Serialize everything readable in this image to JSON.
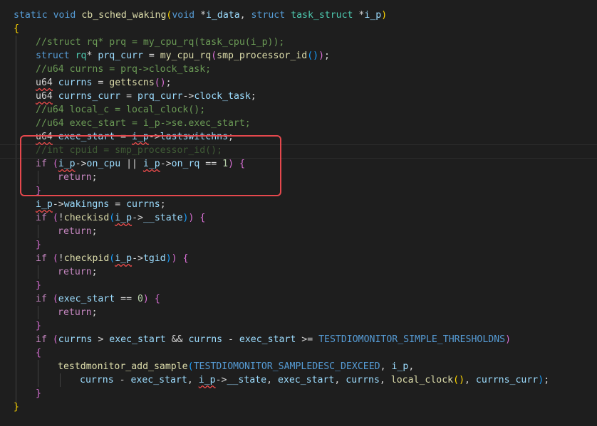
{
  "editor": {
    "language": "c",
    "theme_colors": {
      "background": "#1e1e1e",
      "keyword": "#569cd6",
      "control": "#c586c0",
      "function": "#dcdcaa",
      "type": "#4ec9b0",
      "variable": "#9cdcfe",
      "macro": "#4fc1ff",
      "number": "#b5cea8",
      "comment": "#6a9955",
      "highlight_box": "#e5484d"
    },
    "lines": [
      "static void cb_sched_waking(void *i_data, struct task_struct *i_p)",
      "{",
      "//struct rq* prq = my_cpu_rq(task_cpu(i_p));",
      "struct rq* prq_curr = my_cpu_rq(smp_processor_id());",
      "//u64 currns = prq->clock_task;",
      "u64 currns = gettscns();",
      "u64 currns_curr = prq_curr->clock_task;",
      "//u64 local_c = local_clock();",
      "//u64 exec_start = i_p->se.exec_start;",
      "u64 exec_start = i_p->lastswitchns;",
      "//int cpuid = smp_processor_id();",
      "if (i_p->on_cpu || i_p->on_rq == 1) {",
      "return;",
      "}",
      "i_p->wakingns = currns;",
      "if (!checkisd(i_p->__state)) {",
      "return;",
      "}",
      "if (!checkpid(i_p->tgid)) {",
      "return;",
      "}",
      "if (exec_start == 0) {",
      "return;",
      "}",
      "if (currns > exec_start && currns - exec_start >= TESTDIOMONITOR_SIMPLE_THRESHOLDNS)",
      "{",
      "testdmonitor_add_sample(TESTDIOMONITOR_SAMPLEDESC_DEXCEED, i_p,",
      "currns - exec_start, i_p->__state, exec_start, currns, local_clock(), currns_curr);",
      "}",
      "}"
    ]
  }
}
